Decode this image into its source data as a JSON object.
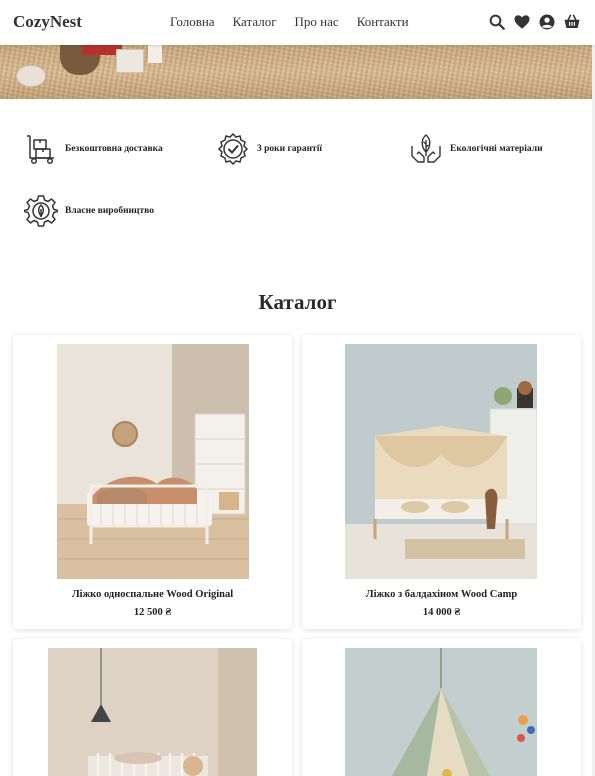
{
  "header": {
    "logo": "CozyNest",
    "nav": [
      "Головна",
      "Каталог",
      "Про нас",
      "Контакти"
    ],
    "icons": [
      "search-icon",
      "heart-icon",
      "user-icon",
      "basket-icon"
    ]
  },
  "features": [
    {
      "label": "Безкоштовна доставка",
      "icon": "delivery-icon"
    },
    {
      "label": "3 роки гарантії",
      "icon": "warranty-badge-icon"
    },
    {
      "label": "Екологічні матеріали",
      "icon": "eco-hands-icon"
    },
    {
      "label": "Власне виробництво",
      "icon": "production-gear-icon"
    }
  ],
  "catalog": {
    "title": "Каталог",
    "products": [
      {
        "name": "Ліжко односпальне Wood Original",
        "price": "12 500 ₴"
      },
      {
        "name": "Ліжко з балдахіном Wood Camp",
        "price": "14 000 ₴"
      },
      {
        "name": "",
        "price": ""
      },
      {
        "name": "",
        "price": ""
      }
    ]
  },
  "colors": {
    "text": "#222222",
    "hero_floor": "#c9a77f",
    "card_bg": "#ffffff"
  }
}
